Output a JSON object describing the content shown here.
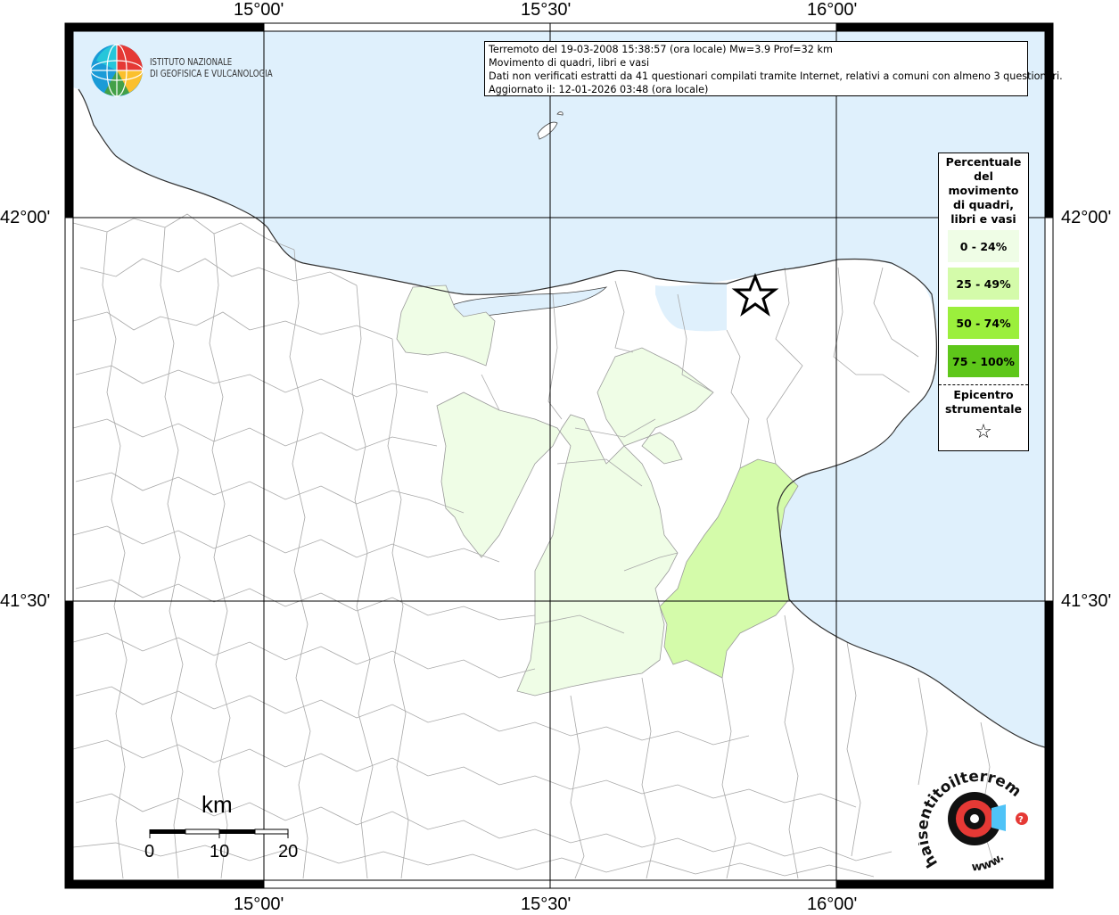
{
  "frame": {
    "top_labels": [
      "15°00'",
      "15°30'",
      "16°00'"
    ],
    "bottom_labels": [
      "15°00'",
      "15°30'",
      "16°00'"
    ],
    "left_labels": [
      "42°00'",
      "41°30'"
    ],
    "right_labels": [
      "42°00'",
      "41°30'"
    ]
  },
  "info": {
    "line1": "Terremoto del 19-03-2008 15:38:57 (ora locale) Mw=3.9 Prof=32 km",
    "line2": "Movimento di quadri, libri e vasi",
    "line3": "Dati non verificati estratti da 41 questionari compilati tramite Internet, relativi a comuni con almeno 3 questionari.",
    "line4": "Aggiornato il: 12-01-2026 03:48 (ora locale)"
  },
  "logo": {
    "line1": "ISTITUTO NAZIONALE",
    "line2": "DI GEOFISICA E VULCANOLOGIA"
  },
  "legend": {
    "title": [
      "Percentuale",
      "del",
      "movimento",
      "di quadri,",
      "libri e vasi"
    ],
    "classes": [
      {
        "label": "0 - 24%",
        "color": "#effde6"
      },
      {
        "label": "25 - 49%",
        "color": "#d4fbaa"
      },
      {
        "label": "50 - 74%",
        "color": "#9bef3c"
      },
      {
        "label": "75 - 100%",
        "color": "#5ec71a"
      }
    ],
    "epicenter": [
      "Epicentro",
      "strumentale"
    ],
    "star": "☆"
  },
  "scale": {
    "title": "km",
    "ticks": [
      "0",
      "10",
      "20"
    ]
  },
  "watermark": {
    "text": "haisentitoilterremoto.it",
    "www": "www."
  },
  "colors": {
    "sea": "#dff0fc",
    "land": "#ffffff",
    "border": "#9a9a9a",
    "class_0_24": "#effde6",
    "class_25_49": "#d4fbaa"
  }
}
